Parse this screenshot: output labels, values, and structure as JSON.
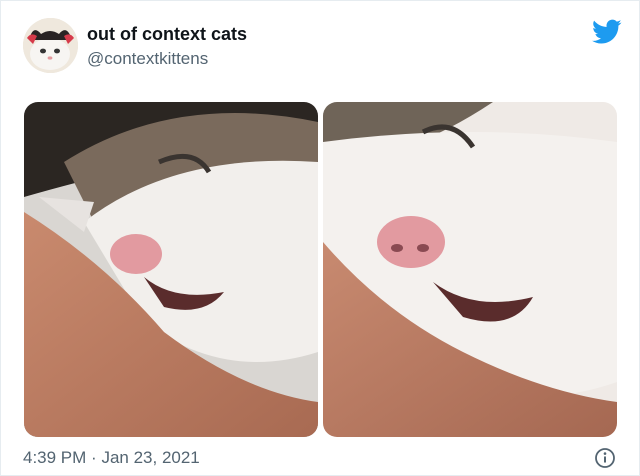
{
  "tweet": {
    "author_name": "out of context cats",
    "author_handle": "@contextkittens",
    "time": "4:39 PM",
    "separator": "·",
    "date": "Jan 23, 2021"
  },
  "icons": {
    "brand": "twitter-bird-icon",
    "info": "info-icon"
  },
  "colors": {
    "twitter_blue": "#1d9bf0",
    "secondary_text": "#536471",
    "primary_text": "#0f1419"
  }
}
